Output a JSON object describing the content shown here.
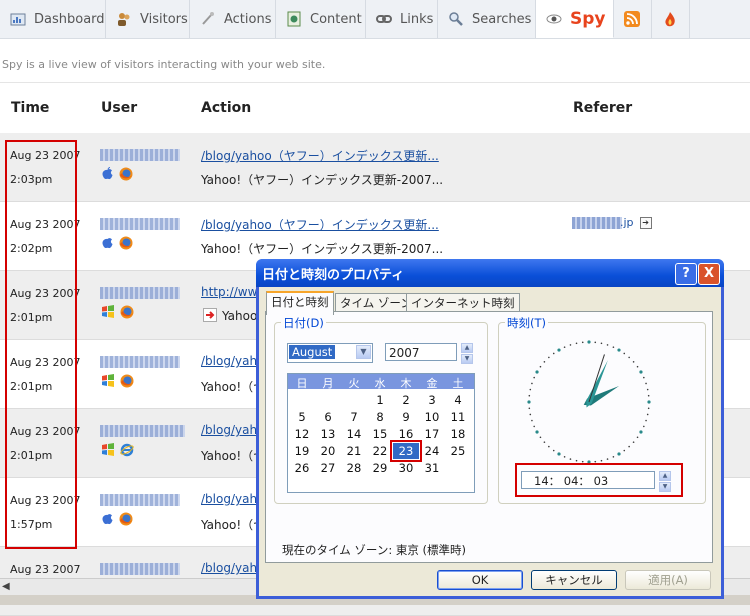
{
  "nav": {
    "tabs": [
      {
        "label": "Dashboard",
        "icon": "dashboard-icon"
      },
      {
        "label": "Visitors",
        "icon": "visitors-icon"
      },
      {
        "label": "Actions",
        "icon": "actions-icon"
      },
      {
        "label": "Content",
        "icon": "content-icon"
      },
      {
        "label": "Links",
        "icon": "links-icon"
      },
      {
        "label": "Searches",
        "icon": "search-icon"
      },
      {
        "label": "Spy",
        "icon": "eye-icon"
      }
    ],
    "active": "Spy"
  },
  "subtitle": "Spy is a live view of visitors interacting with your web site.",
  "table": {
    "headers": {
      "time": "Time",
      "user": "User",
      "action": "Action",
      "referer": "Referer"
    },
    "rows": [
      {
        "date": "Aug 23 2007",
        "time": "2:03pm",
        "action_link": "/blog/yahoo（ヤフー）インデックス更新...",
        "action_title": "Yahoo!（ヤフー）インデックス更新-2007...",
        "referer": ""
      },
      {
        "date": "Aug 23 2007",
        "time": "2:02pm",
        "action_link": "/blog/yahoo（ヤフー）インデックス更新...",
        "action_title": "Yahoo!（ヤフー）インデックス更新-2007...",
        "referer": ".jp"
      },
      {
        "date": "Aug 23 2007",
        "time": "2:01pm",
        "action_link": "http://ww",
        "action_title": "Yahoo!",
        "referer": ""
      },
      {
        "date": "Aug 23 2007",
        "time": "2:01pm",
        "action_link": "/blog/yahoo",
        "action_title": "Yahoo!（ヤ",
        "referer": ""
      },
      {
        "date": "Aug 23 2007",
        "time": "2:01pm",
        "action_link": "/blog/yahoo",
        "action_title": "Yahoo!（ヤ",
        "referer": ""
      },
      {
        "date": "Aug 23 2007",
        "time": "1:57pm",
        "action_link": "/blog/yahoo",
        "action_title": "Yahoo!（ヤ",
        "referer": ""
      },
      {
        "date": "Aug 23 2007",
        "time": "",
        "action_link": "/blog/yahoo",
        "action_title": "",
        "referer": ""
      }
    ]
  },
  "dialog": {
    "title": "日付と時刻のプロパティ",
    "tabs": [
      "日付と時刻",
      "タイム ゾーン",
      "インターネット時刻"
    ],
    "date_group": "日付(D)",
    "time_group": "時刻(T)",
    "month": "August",
    "year": "2007",
    "weekdays": [
      "日",
      "月",
      "火",
      "水",
      "木",
      "金",
      "土"
    ],
    "days": [
      "1",
      "2",
      "3",
      "4",
      "5",
      "6",
      "7",
      "8",
      "9",
      "10",
      "11",
      "12",
      "13",
      "14",
      "15",
      "16",
      "17",
      "18",
      "19",
      "20",
      "21",
      "22",
      "23",
      "24",
      "25",
      "26",
      "27",
      "28",
      "29",
      "30",
      "31"
    ],
    "selected_day": "23",
    "time_value": "14： 04： 03",
    "timezone_label": "現在のタイム ゾーン: 東京 (標準時)",
    "buttons": {
      "ok": "OK",
      "cancel": "キャンセル",
      "apply": "適用(A)"
    },
    "help": "?",
    "close": "X"
  },
  "colors": {
    "accent": "#e8431d",
    "link": "#1a4fa0",
    "highlight": "#d40000",
    "xp_title": "#0a4fd8"
  }
}
